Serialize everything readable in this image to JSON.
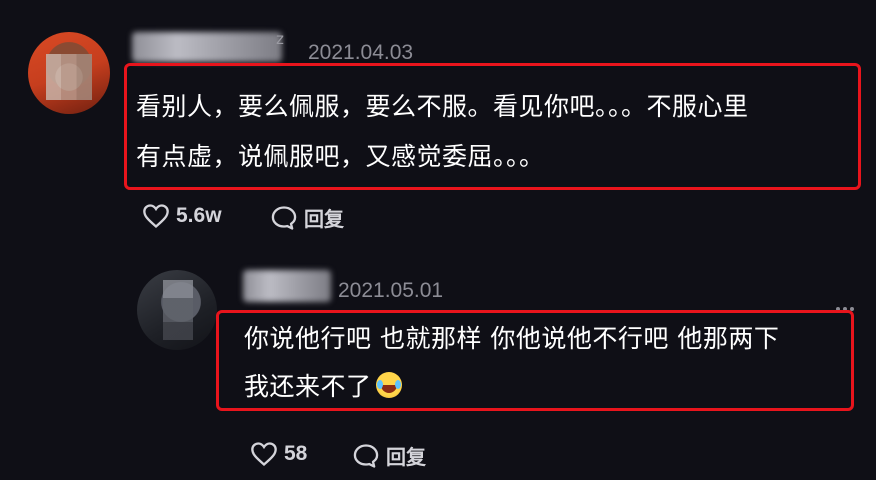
{
  "comments": [
    {
      "date": "2021.04.03",
      "name_glyph": "z",
      "text_line1": "看别人，要么佩服，要么不服。看见你吧。。。不服心里",
      "text_line2": "有点虚，说佩服吧，又感觉委屈。。。",
      "likes": "5.6w",
      "reply_label": "回复"
    },
    {
      "date": "2021.05.01",
      "text_line1": "你说他行吧 也就那样 你他说他不行吧 他那两下",
      "text_line2": "我还来不了",
      "emoji": "laughing-crying-emoji",
      "likes": "58",
      "reply_label": "回复"
    }
  ],
  "colors": {
    "background": "#0f0f16",
    "highlight": "#e8141c",
    "date": "#8c8c95"
  },
  "icons": [
    "heart-icon",
    "comment-bubble-icon",
    "more-icon"
  ]
}
